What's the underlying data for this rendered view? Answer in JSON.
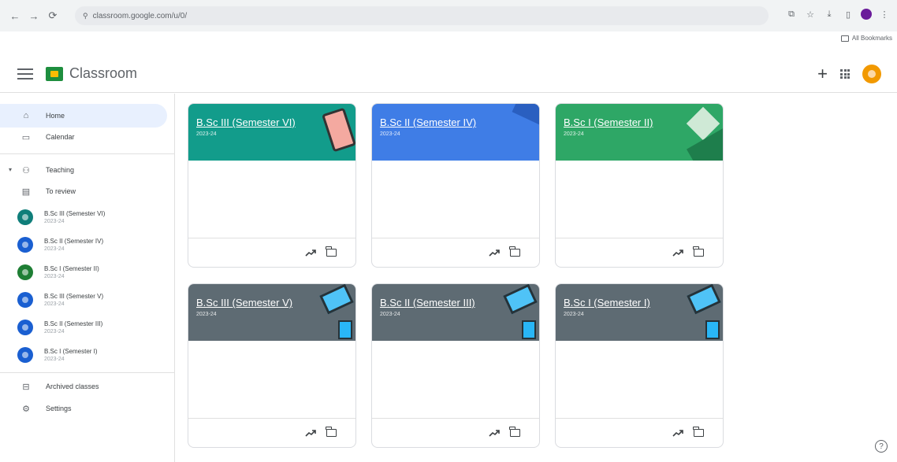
{
  "browser": {
    "url": "classroom.google.com/u/0/",
    "bookmarks_label": "All Bookmarks"
  },
  "app": {
    "title": "Classroom"
  },
  "sidebar": {
    "home": "Home",
    "calendar": "Calendar",
    "teaching": "Teaching",
    "to_review": "To review",
    "courses": [
      {
        "name": "B.Sc III (Semester VI)",
        "year": "2023-24",
        "color": "#0f7e7a"
      },
      {
        "name": "B.Sc II (Semester IV)",
        "year": "2023-24",
        "color": "#1a5fd1"
      },
      {
        "name": "B.Sc I (Semester II)",
        "year": "2023-24",
        "color": "#1e7e34"
      },
      {
        "name": "B.Sc III (Semester V)",
        "year": "2023-24",
        "color": "#1a5fd1"
      },
      {
        "name": "B.Sc II (Semester III)",
        "year": "2023-24",
        "color": "#1a5fd1"
      },
      {
        "name": "B.Sc I (Semester I)",
        "year": "2023-24",
        "color": "#1a5fd1"
      }
    ],
    "archived": "Archived classes",
    "settings": "Settings"
  },
  "cards": [
    {
      "title": "B.Sc III (Semester VI)",
      "year": "2023-24",
      "color": "#129c8b"
    },
    {
      "title": "B.Sc II (Semester IV)",
      "year": "2023-24",
      "color": "#3f7de6"
    },
    {
      "title": "B.Sc I (Semester II)",
      "year": "2023-24",
      "color": "#2ea766"
    },
    {
      "title": "B.Sc III (Semester V)",
      "year": "2023-24",
      "color": "#5e6b73"
    },
    {
      "title": "B.Sc II (Semester III)",
      "year": "2023-24",
      "color": "#5e6b73"
    },
    {
      "title": "B.Sc I (Semester I)",
      "year": "2023-24",
      "color": "#5e6b73"
    }
  ]
}
